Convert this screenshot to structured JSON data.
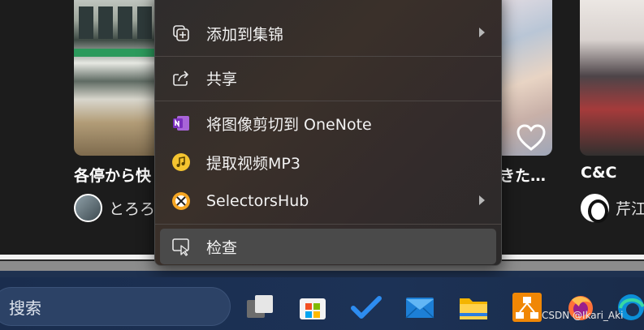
{
  "gallery": {
    "cards": [
      {
        "title": "各停から快",
        "author": "とろろ"
      },
      {
        "title": "きた…"
      },
      {
        "title": "C&C",
        "author": "芹江"
      }
    ]
  },
  "context_menu": {
    "items": [
      {
        "label": "添加到集锦",
        "icon": "collections-add-icon",
        "has_submenu": true
      },
      {
        "label": "共享",
        "icon": "share-icon",
        "has_submenu": false
      },
      {
        "label": "将图像剪切到 OneNote",
        "icon": "onenote-icon",
        "has_submenu": false
      },
      {
        "label": "提取视频MP3",
        "icon": "mp3-extract-icon",
        "has_submenu": false
      },
      {
        "label": "SelectorsHub",
        "icon": "selectorshub-icon",
        "has_submenu": true
      },
      {
        "label": "检查",
        "icon": "inspect-icon",
        "has_submenu": false,
        "highlighted": true
      }
    ]
  },
  "taskbar": {
    "search_placeholder": "搜索",
    "apps": [
      "task-view-icon",
      "microsoft-store-icon",
      "todo-icon",
      "mail-icon",
      "file-explorer-icon",
      "drawio-icon",
      "firefox-icon",
      "edge-icon"
    ]
  },
  "watermark": "CSDN @Ikari_Aki",
  "colors": {
    "taskbar_bg": "#1c3256",
    "menu_bg": "#332e2c",
    "menu_highlight": "#4a4a4a",
    "onenote_purple": "#7b2fbe"
  }
}
